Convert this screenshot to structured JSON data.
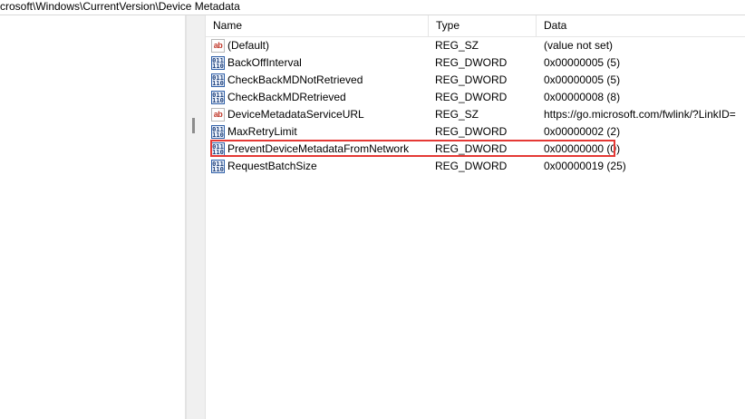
{
  "address_bar": {
    "path": "crosoft\\Windows\\CurrentVersion\\Device Metadata"
  },
  "list": {
    "columns": {
      "name": "Name",
      "type": "Type",
      "data": "Data"
    },
    "rows": [
      {
        "icon": "string-value-icon",
        "icon_glyph": "ab",
        "name": "(Default)",
        "type": "REG_SZ",
        "data": "(value not set)"
      },
      {
        "icon": "binary-value-icon",
        "icon_glyph": "011\n110",
        "name": "BackOffInterval",
        "type": "REG_DWORD",
        "data": "0x00000005 (5)"
      },
      {
        "icon": "binary-value-icon",
        "icon_glyph": "011\n110",
        "name": "CheckBackMDNotRetrieved",
        "type": "REG_DWORD",
        "data": "0x00000005 (5)"
      },
      {
        "icon": "binary-value-icon",
        "icon_glyph": "011\n110",
        "name": "CheckBackMDRetrieved",
        "type": "REG_DWORD",
        "data": "0x00000008 (8)"
      },
      {
        "icon": "string-value-icon",
        "icon_glyph": "ab",
        "name": "DeviceMetadataServiceURL",
        "type": "REG_SZ",
        "data": "https://go.microsoft.com/fwlink/?LinkID="
      },
      {
        "icon": "binary-value-icon",
        "icon_glyph": "011\n110",
        "name": "MaxRetryLimit",
        "type": "REG_DWORD",
        "data": "0x00000002 (2)"
      },
      {
        "icon": "binary-value-icon",
        "icon_glyph": "011\n110",
        "name": "PreventDeviceMetadataFromNetwork",
        "type": "REG_DWORD",
        "data": "0x00000000 (0)"
      },
      {
        "icon": "binary-value-icon",
        "icon_glyph": "011\n110",
        "name": "RequestBatchSize",
        "type": "REG_DWORD",
        "data": "0x00000019 (25)"
      }
    ]
  },
  "highlight_color": "#e53935"
}
